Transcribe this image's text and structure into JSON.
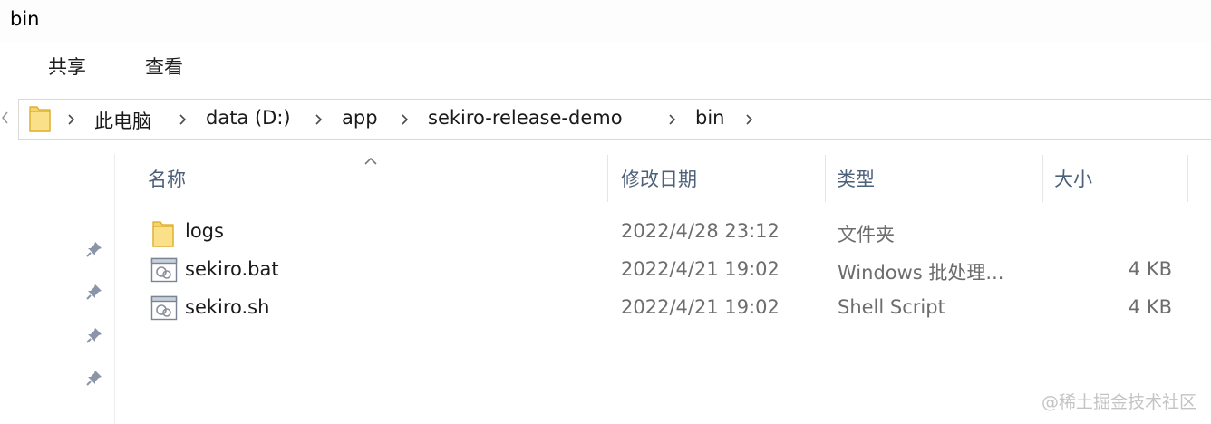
{
  "window": {
    "title": "bin"
  },
  "ribbon": {
    "tabs": [
      "共享",
      "查看"
    ]
  },
  "address": {
    "crumbs": [
      "此电脑",
      "data (D:)",
      "app",
      "sekiro-release-demo",
      "bin"
    ]
  },
  "columns": {
    "name": "名称",
    "date": "修改日期",
    "type": "类型",
    "size": "大小"
  },
  "files": [
    {
      "icon": "folder-icon",
      "name": "logs",
      "date": "2022/4/28 23:12",
      "type": "文件夹",
      "size": ""
    },
    {
      "icon": "script-file-icon",
      "name": "sekiro.bat",
      "date": "2022/4/21 19:02",
      "type": "Windows 批处理...",
      "size": "4 KB"
    },
    {
      "icon": "script-file-icon",
      "name": "sekiro.sh",
      "date": "2022/4/21 19:02",
      "type": "Shell Script",
      "size": "4 KB"
    }
  ],
  "watermark": "@稀土掘金技术社区",
  "colors": {
    "header_text": "#4c607a",
    "folder": "#f6d36b",
    "secondary_text": "#6d6d6d"
  }
}
